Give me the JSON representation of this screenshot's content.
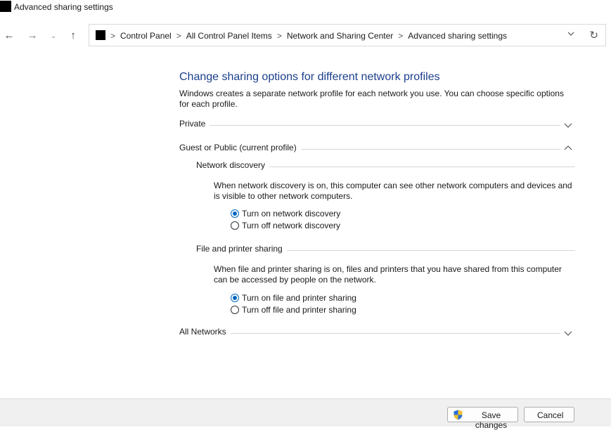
{
  "window": {
    "title": "Advanced sharing settings"
  },
  "breadcrumb": {
    "items": [
      "Control Panel",
      "All Control Panel Items",
      "Network and Sharing Center",
      "Advanced sharing settings"
    ],
    "separator": ">"
  },
  "icons": {
    "back": "arrow-left-icon",
    "forward": "arrow-right-icon",
    "recent": "chevron-down-icon",
    "up": "arrow-up-icon",
    "refresh": "refresh-icon",
    "uac": "uac-shield-icon"
  },
  "main": {
    "heading": "Change sharing options for different network profiles",
    "description": "Windows creates a separate network profile for each network you use. You can choose specific options for each profile.",
    "profiles": {
      "private": {
        "label": "Private",
        "expanded": false
      },
      "guest": {
        "label": "Guest or Public (current profile)",
        "expanded": true,
        "network_discovery": {
          "label": "Network discovery",
          "description": "When network discovery is on, this computer can see other network computers and devices and is visible to other network computers.",
          "options": [
            "Turn on network discovery",
            "Turn off network discovery"
          ],
          "selected": "Turn on network discovery"
        },
        "file_sharing": {
          "label": "File and printer sharing",
          "description": "When file and printer sharing is on, files and printers that you have shared from this computer can be accessed by people on the network.",
          "options": [
            "Turn on file and printer sharing",
            "Turn off file and printer sharing"
          ],
          "selected": "Turn on file and printer sharing"
        }
      },
      "all": {
        "label": "All Networks",
        "expanded": false
      }
    }
  },
  "footer": {
    "save_label": "Save changes",
    "cancel_label": "Cancel"
  },
  "colors": {
    "heading": "#1b3f8b",
    "accent": "#0067c0",
    "footer_bg": "#f0f0f0"
  }
}
